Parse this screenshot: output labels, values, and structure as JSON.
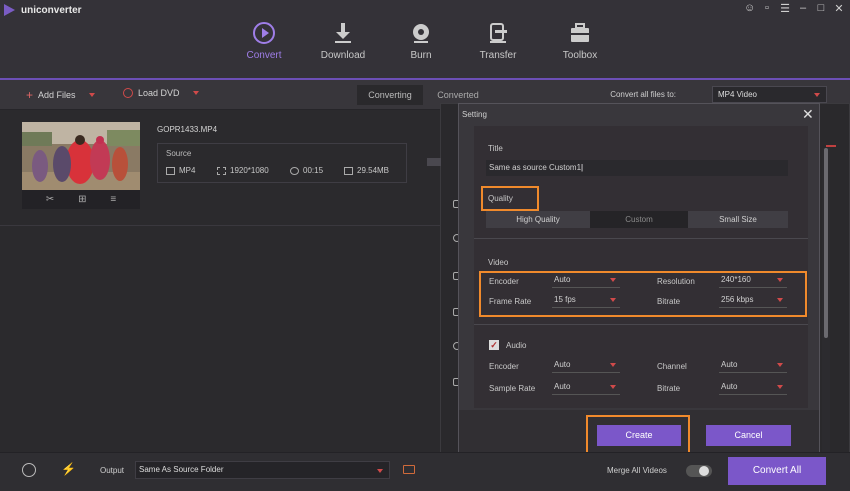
{
  "app": {
    "title": "uniconverter"
  },
  "window_controls": [
    "user-icon",
    "chat-icon",
    "menu-icon",
    "minimize-icon",
    "maximize-icon",
    "close-icon"
  ],
  "nav": [
    {
      "label": "Convert",
      "icon": "convert-icon",
      "active": true
    },
    {
      "label": "Download",
      "icon": "download-icon",
      "active": false
    },
    {
      "label": "Burn",
      "icon": "burn-icon",
      "active": false
    },
    {
      "label": "Transfer",
      "icon": "transfer-icon",
      "active": false
    },
    {
      "label": "Toolbox",
      "icon": "toolbox-icon",
      "active": false
    }
  ],
  "toolbar": {
    "add_files": "Add Files",
    "load_dvd": "Load DVD",
    "tabs": [
      "Converting",
      "Converted"
    ],
    "convert_all_label": "Convert all files to:",
    "convert_all_value": "MP4 Video"
  },
  "file": {
    "name": "GOPR1433.MP4",
    "source_label": "Source",
    "format": "MP4",
    "resolution": "1920*1080",
    "duration": "00:15",
    "size": "29.54MB"
  },
  "dialog": {
    "title": "Setting",
    "title_label": "Title",
    "title_value": "Same as source Custom1",
    "quality_label": "Quality",
    "quality_options": [
      "High Quality",
      "Custom",
      "Small Size"
    ],
    "quality_selected": "Custom",
    "video_label": "Video",
    "video": {
      "encoder_label": "Encoder",
      "encoder_value": "Auto",
      "resolution_label": "Resolution",
      "resolution_value": "240*160",
      "framerate_label": "Frame Rate",
      "framerate_value": "15 fps",
      "bitrate_label": "Bitrate",
      "bitrate_value": "256 kbps"
    },
    "audio_label": "Audio",
    "audio": {
      "encoder_label": "Encoder",
      "encoder_value": "Auto",
      "channel_label": "Channel",
      "channel_value": "Auto",
      "samplerate_label": "Sample Rate",
      "samplerate_value": "Auto",
      "bitrate_label": "Bitrate",
      "bitrate_value": "Auto"
    },
    "create_label": "Create",
    "cancel_label": "Cancel"
  },
  "bottom": {
    "output_label": "Output",
    "output_value": "Same As Source Folder",
    "merge_label": "Merge All Videos",
    "convert_all": "Convert All"
  },
  "colors": {
    "accent": "#7b57c9",
    "highlight": "#f08a2c",
    "background": "#2b2a2d"
  }
}
